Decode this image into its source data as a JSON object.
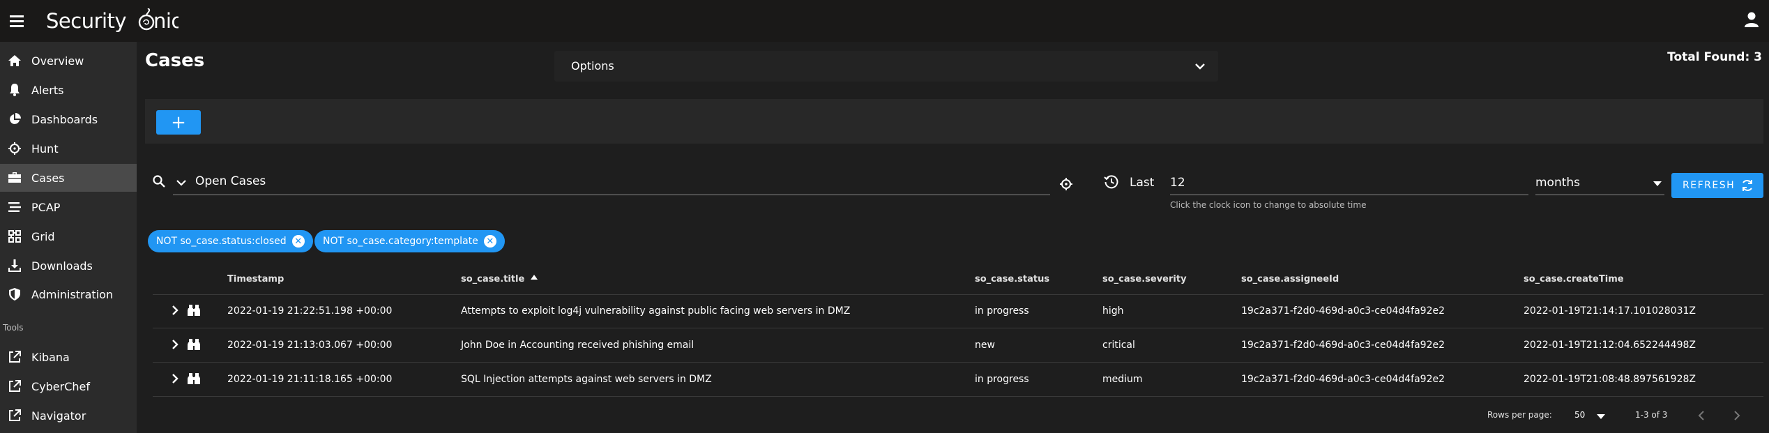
{
  "header": {
    "logo": "Security Onion"
  },
  "sidebar": {
    "items": [
      {
        "label": "Overview",
        "icon": "home-icon"
      },
      {
        "label": "Alerts",
        "icon": "bell-icon"
      },
      {
        "label": "Dashboards",
        "icon": "pie-chart-icon"
      },
      {
        "label": "Hunt",
        "icon": "crosshairs-icon"
      },
      {
        "label": "Cases",
        "icon": "briefcase-icon",
        "active": true
      },
      {
        "label": "PCAP",
        "icon": "stream-icon"
      },
      {
        "label": "Grid",
        "icon": "grid-icon"
      },
      {
        "label": "Downloads",
        "icon": "download-icon"
      },
      {
        "label": "Administration",
        "icon": "shield-icon"
      }
    ],
    "tools_label": "Tools",
    "tools": [
      {
        "label": "Kibana",
        "icon": "external-link-icon"
      },
      {
        "label": "CyberChef",
        "icon": "external-link-icon"
      },
      {
        "label": "Navigator",
        "icon": "external-link-icon"
      }
    ]
  },
  "main": {
    "title": "Cases",
    "options_label": "Options",
    "total_found": "Total Found: 3",
    "add_label": "+",
    "query_value": "Open Cases",
    "time_label": "Last",
    "time_value": "12",
    "time_unit": "months",
    "time_hint": "Click the clock icon to change to absolute time",
    "refresh_label": "REFRESH",
    "filters": [
      "NOT so_case.status:closed",
      "NOT so_case.category:template"
    ]
  },
  "table": {
    "headers": [
      "Timestamp",
      "so_case.title",
      "so_case.status",
      "so_case.severity",
      "so_case.assigneeId",
      "so_case.createTime"
    ],
    "rows": [
      [
        "2022-01-19 21:22:51.198 +00:00",
        "Attempts to exploit log4j vulnerability against public facing web servers in DMZ",
        "in progress",
        "high",
        "19c2a371-f2d0-469d-a0c3-ce04d4fa92e2",
        "2022-01-19T21:14:17.101028031Z"
      ],
      [
        "2022-01-19 21:13:03.067 +00:00",
        "John Doe in Accounting received phishing email",
        "new",
        "critical",
        "19c2a371-f2d0-469d-a0c3-ce04d4fa92e2",
        "2022-01-19T21:12:04.652244498Z"
      ],
      [
        "2022-01-19 21:11:18.165 +00:00",
        "SQL Injection attempts against web servers in DMZ",
        "in progress",
        "medium",
        "19c2a371-f2d0-469d-a0c3-ce04d4fa92e2",
        "2022-01-19T21:08:48.897561928Z"
      ]
    ],
    "footer": {
      "rows_per_page_label": "Rows per page:",
      "rows_per_page": "50",
      "range": "1-3 of 3"
    }
  },
  "colors": {
    "accent": "#2196f3",
    "background": "#1e1e1e",
    "sidebar": "#2b2b2b",
    "topbar": "#1a1918"
  }
}
